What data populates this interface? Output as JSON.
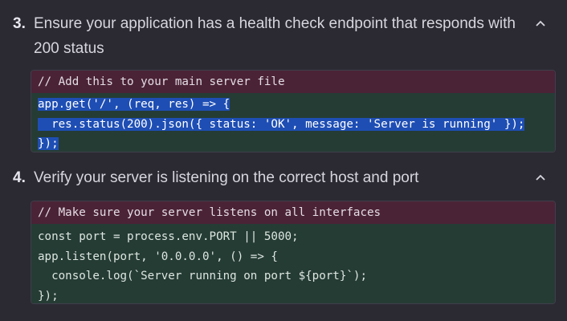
{
  "steps": [
    {
      "number": "3.",
      "text": "Ensure your application has a health check endpoint that responds with 200 status",
      "code": {
        "comment": "// Add this to your main server file",
        "lines": [
          "app.get('/', (req, res) => {",
          "  res.status(200).json({ status: 'OK', message: 'Server is running' });",
          "});"
        ],
        "selected": true
      },
      "collapse_icon": "chevron-up-icon"
    },
    {
      "number": "4.",
      "text": "Verify your server is listening on the correct host and port",
      "code": {
        "comment": "// Make sure your server listens on all interfaces",
        "lines": [
          "const port = process.env.PORT || 5000;",
          "app.listen(port, '0.0.0.0', () => {",
          "  console.log(`Server running on port ${port}`);",
          "});"
        ],
        "selected": false
      },
      "collapse_icon": "chevron-up-icon"
    }
  ],
  "colors": {
    "background": "#2b2a33",
    "comment_bg": "#4b2336",
    "code_bg": "#253c35",
    "selection": "#1e4eb4"
  }
}
